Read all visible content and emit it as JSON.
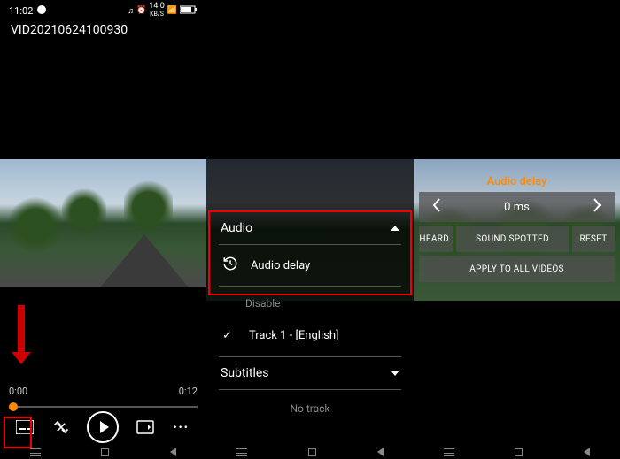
{
  "panel1": {
    "status": {
      "time": "11:02",
      "net_speed": "14.0",
      "net_unit": "KB/S"
    },
    "title": "VID20210624100930",
    "time_current": "0:00",
    "time_total": "0:12"
  },
  "panel2": {
    "audio_header": "Audio",
    "audio_delay": "Audio delay",
    "disable": "Disable",
    "track": "Track 1 - [English]",
    "subtitles_header": "Subtitles",
    "no_track": "No track"
  },
  "panel3": {
    "title": "Audio delay",
    "value": "0 ms",
    "btn_heard": "SOUND HEARD",
    "btn_spotted": "SOUND SPOTTED",
    "btn_reset": "RESET",
    "btn_apply": "APPLY TO ALL VIDEOS"
  }
}
